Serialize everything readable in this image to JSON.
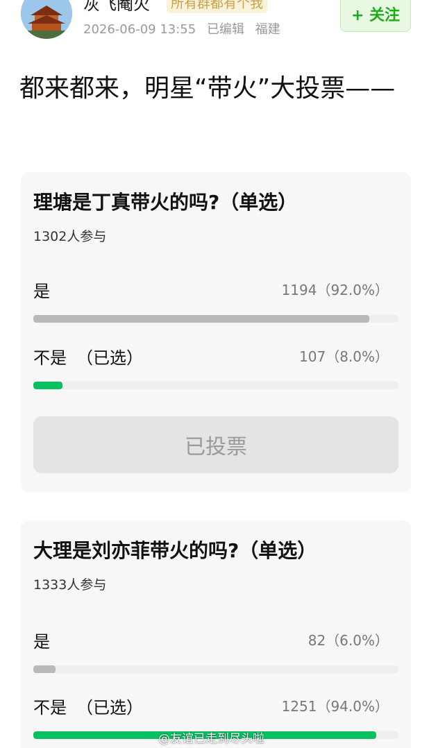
{
  "header": {
    "username": "灰飞阉火",
    "badge": "所有群都有个我",
    "date": "2026-06-09 13:55",
    "edited": "已编辑",
    "location": "福建",
    "follow_label": "+ 关注"
  },
  "post": {
    "title": "都来都来，明星“带火”大投票——"
  },
  "polls": [
    {
      "question": "理塘是丁真带火的吗?（单选）",
      "participants": "1302人参与",
      "options": [
        {
          "label": "是",
          "selected_mark": "",
          "stat": "1194（92.0%）",
          "percent": 92.0,
          "selected": false
        },
        {
          "label": "不是",
          "selected_mark": "（已选）",
          "stat": "107（8.0%）",
          "percent": 8.0,
          "selected": true
        }
      ],
      "button_label": "已投票"
    },
    {
      "question": "大理是刘亦菲带火的吗?（单选）",
      "participants": "1333人参与",
      "options": [
        {
          "label": "是",
          "selected_mark": "",
          "stat": "82（6.0%）",
          "percent": 6.0,
          "selected": false
        },
        {
          "label": "不是",
          "selected_mark": "（已选）",
          "stat": "1251（94.0%）",
          "percent": 94.0,
          "selected": true
        }
      ]
    }
  ],
  "watermark": "@友谊已走到尽头啦",
  "colors": {
    "accent_green": "#07c160",
    "bar_gray": "#b9b9b9",
    "follow_text": "#1aad19"
  }
}
